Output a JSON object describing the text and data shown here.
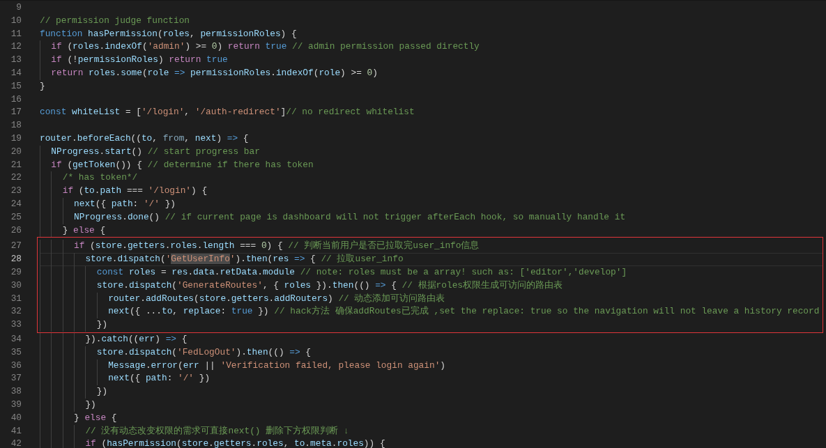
{
  "editor": {
    "blocks": [
      {
        "boxed": false,
        "lines": [
          {
            "number": "9",
            "current": false
          },
          {
            "number": "10",
            "current": false,
            "tokens": [
              {
                "kind": "comment",
                "text": "// permission judge function"
              }
            ]
          },
          {
            "number": "11",
            "current": false,
            "tokens": [
              {
                "kind": "keyword",
                "text": "function"
              },
              {
                "kind": "ident",
                "text": " hasPermission"
              },
              {
                "kind": "plain",
                "text": "("
              },
              {
                "kind": "ident",
                "text": "roles"
              },
              {
                "kind": "plain",
                "text": ", "
              },
              {
                "kind": "ident",
                "text": "permissionRoles"
              },
              {
                "kind": "plain",
                "text": ") {"
              }
            ]
          },
          {
            "number": "12",
            "current": false,
            "tokens": [
              {
                "kind": "control",
                "text": "  if"
              },
              {
                "kind": "plain",
                "text": " ("
              },
              {
                "kind": "ident",
                "text": "roles"
              },
              {
                "kind": "plain",
                "text": "."
              },
              {
                "kind": "ident",
                "text": "indexOf"
              },
              {
                "kind": "plain",
                "text": "("
              },
              {
                "kind": "string",
                "text": "'admin'"
              },
              {
                "kind": "plain",
                "text": ") >= "
              },
              {
                "kind": "number",
                "text": "0"
              },
              {
                "kind": "plain",
                "text": ") "
              },
              {
                "kind": "control",
                "text": "return"
              },
              {
                "kind": "keyword",
                "text": " true"
              },
              {
                "kind": "comment",
                "text": " // admin permission passed directly"
              }
            ]
          },
          {
            "number": "13",
            "current": false,
            "tokens": [
              {
                "kind": "control",
                "text": "  if"
              },
              {
                "kind": "plain",
                "text": " (!"
              },
              {
                "kind": "ident",
                "text": "permissionRoles"
              },
              {
                "kind": "plain",
                "text": ") "
              },
              {
                "kind": "control",
                "text": "return"
              },
              {
                "kind": "keyword",
                "text": " true"
              }
            ]
          },
          {
            "number": "14",
            "current": false,
            "tokens": [
              {
                "kind": "control",
                "text": "  return"
              },
              {
                "kind": "ident",
                "text": " roles"
              },
              {
                "kind": "plain",
                "text": "."
              },
              {
                "kind": "ident",
                "text": "some"
              },
              {
                "kind": "plain",
                "text": "("
              },
              {
                "kind": "ident",
                "text": "role"
              },
              {
                "kind": "keyword",
                "text": " =>"
              },
              {
                "kind": "ident",
                "text": " permissionRoles"
              },
              {
                "kind": "plain",
                "text": "."
              },
              {
                "kind": "ident",
                "text": "indexOf"
              },
              {
                "kind": "plain",
                "text": "("
              },
              {
                "kind": "ident",
                "text": "role"
              },
              {
                "kind": "plain",
                "text": ") >= "
              },
              {
                "kind": "number",
                "text": "0"
              },
              {
                "kind": "plain",
                "text": ")"
              }
            ]
          },
          {
            "number": "15",
            "current": false,
            "tokens": [
              {
                "kind": "plain",
                "text": "}"
              }
            ]
          },
          {
            "number": "16",
            "current": false
          },
          {
            "number": "17",
            "current": false,
            "tokens": [
              {
                "kind": "keyword",
                "text": "const"
              },
              {
                "kind": "ident",
                "text": " whiteList"
              },
              {
                "kind": "plain",
                "text": " = ["
              },
              {
                "kind": "string",
                "text": "'/login'"
              },
              {
                "kind": "plain",
                "text": ", "
              },
              {
                "kind": "string",
                "text": "'/auth-redirect'"
              },
              {
                "kind": "plain",
                "text": "]"
              },
              {
                "kind": "comment",
                "text": "// no redirect whitelist"
              }
            ]
          },
          {
            "number": "18",
            "current": false
          },
          {
            "number": "19",
            "current": false,
            "tokens": [
              {
                "kind": "ident",
                "text": "router"
              },
              {
                "kind": "plain",
                "text": "."
              },
              {
                "kind": "ident",
                "text": "beforeEach"
              },
              {
                "kind": "plain",
                "text": "(("
              },
              {
                "kind": "ident",
                "text": "to"
              },
              {
                "kind": "plain",
                "text": ", "
              },
              {
                "kind": "dim",
                "text": "from"
              },
              {
                "kind": "plain",
                "text": ", "
              },
              {
                "kind": "ident",
                "text": "next"
              },
              {
                "kind": "plain",
                "text": ") "
              },
              {
                "kind": "keyword",
                "text": "=>"
              },
              {
                "kind": "plain",
                "text": " {"
              }
            ]
          },
          {
            "number": "20",
            "current": false,
            "tokens": [
              {
                "kind": "ident",
                "text": "  NProgress"
              },
              {
                "kind": "plain",
                "text": "."
              },
              {
                "kind": "ident",
                "text": "start"
              },
              {
                "kind": "plain",
                "text": "() "
              },
              {
                "kind": "comment",
                "text": "// start progress bar"
              }
            ]
          },
          {
            "number": "21",
            "current": false,
            "tokens": [
              {
                "kind": "control",
                "text": "  if"
              },
              {
                "kind": "plain",
                "text": " ("
              },
              {
                "kind": "ident",
                "text": "getToken"
              },
              {
                "kind": "plain",
                "text": "()) { "
              },
              {
                "kind": "comment",
                "text": "// determine if there has token"
              }
            ]
          },
          {
            "number": "22",
            "current": false,
            "tokens": [
              {
                "kind": "comment",
                "text": "    /* has token*/"
              }
            ]
          },
          {
            "number": "23",
            "current": false,
            "tokens": [
              {
                "kind": "control",
                "text": "    if"
              },
              {
                "kind": "plain",
                "text": " ("
              },
              {
                "kind": "ident",
                "text": "to"
              },
              {
                "kind": "plain",
                "text": "."
              },
              {
                "kind": "ident",
                "text": "path"
              },
              {
                "kind": "plain",
                "text": " === "
              },
              {
                "kind": "string",
                "text": "'/login'"
              },
              {
                "kind": "plain",
                "text": ") {"
              }
            ]
          },
          {
            "number": "24",
            "current": false,
            "tokens": [
              {
                "kind": "ident",
                "text": "      next"
              },
              {
                "kind": "plain",
                "text": "({ "
              },
              {
                "kind": "ident",
                "text": "path"
              },
              {
                "kind": "plain",
                "text": ": "
              },
              {
                "kind": "string",
                "text": "'/'"
              },
              {
                "kind": "plain",
                "text": " })"
              }
            ]
          },
          {
            "number": "25",
            "current": false,
            "tokens": [
              {
                "kind": "ident",
                "text": "      NProgress"
              },
              {
                "kind": "plain",
                "text": "."
              },
              {
                "kind": "ident",
                "text": "done"
              },
              {
                "kind": "plain",
                "text": "() "
              },
              {
                "kind": "comment",
                "text": "// if current page is dashboard will not trigger afterEach hook, so manually handle it"
              }
            ]
          },
          {
            "number": "26",
            "current": false,
            "tokens": [
              {
                "kind": "plain",
                "text": "    } "
              },
              {
                "kind": "control",
                "text": "else"
              },
              {
                "kind": "plain",
                "text": " {"
              }
            ]
          }
        ]
      },
      {
        "boxed": true,
        "lines": [
          {
            "number": "27",
            "current": false,
            "tokens": [
              {
                "kind": "control",
                "text": "      if"
              },
              {
                "kind": "plain",
                "text": " ("
              },
              {
                "kind": "ident",
                "text": "store"
              },
              {
                "kind": "plain",
                "text": "."
              },
              {
                "kind": "ident",
                "text": "getters"
              },
              {
                "kind": "plain",
                "text": "."
              },
              {
                "kind": "ident",
                "text": "roles"
              },
              {
                "kind": "plain",
                "text": "."
              },
              {
                "kind": "ident",
                "text": "length"
              },
              {
                "kind": "plain",
                "text": " === "
              },
              {
                "kind": "number",
                "text": "0"
              },
              {
                "kind": "plain",
                "text": ") { "
              },
              {
                "kind": "comment",
                "text": "// 判断当前用户是否已拉取完user_info信息"
              }
            ]
          },
          {
            "number": "28",
            "current": true,
            "tokens": [
              {
                "kind": "ident",
                "text": "        store"
              },
              {
                "kind": "plain",
                "text": "."
              },
              {
                "kind": "ident",
                "text": "dispatch"
              },
              {
                "kind": "plain",
                "text": "("
              },
              {
                "kind": "string",
                "text": "'"
              },
              {
                "kind": "match",
                "text": "GetUserInfo"
              },
              {
                "kind": "string",
                "text": "'"
              },
              {
                "kind": "plain",
                "text": ")."
              },
              {
                "kind": "ident",
                "text": "then"
              },
              {
                "kind": "plain",
                "text": "("
              },
              {
                "kind": "ident",
                "text": "res"
              },
              {
                "kind": "keyword",
                "text": " =>"
              },
              {
                "kind": "plain",
                "text": " { "
              },
              {
                "kind": "comment",
                "text": "// 拉取user_info"
              }
            ]
          },
          {
            "number": "29",
            "current": false,
            "tokens": [
              {
                "kind": "keyword",
                "text": "          const"
              },
              {
                "kind": "ident",
                "text": " roles"
              },
              {
                "kind": "plain",
                "text": " = "
              },
              {
                "kind": "ident",
                "text": "res"
              },
              {
                "kind": "plain",
                "text": "."
              },
              {
                "kind": "ident",
                "text": "data"
              },
              {
                "kind": "plain",
                "text": "."
              },
              {
                "kind": "ident",
                "text": "retData"
              },
              {
                "kind": "plain",
                "text": "."
              },
              {
                "kind": "ident",
                "text": "module"
              },
              {
                "kind": "comment",
                "text": " // note: roles must be a array! such as: ['editor','develop']"
              }
            ]
          },
          {
            "number": "30",
            "current": false,
            "tokens": [
              {
                "kind": "ident",
                "text": "          store"
              },
              {
                "kind": "plain",
                "text": "."
              },
              {
                "kind": "ident",
                "text": "dispatch"
              },
              {
                "kind": "plain",
                "text": "("
              },
              {
                "kind": "string",
                "text": "'GenerateRoutes'"
              },
              {
                "kind": "plain",
                "text": ", { "
              },
              {
                "kind": "ident",
                "text": "roles"
              },
              {
                "kind": "plain",
                "text": " })."
              },
              {
                "kind": "ident",
                "text": "then"
              },
              {
                "kind": "plain",
                "text": "(() "
              },
              {
                "kind": "keyword",
                "text": "=>"
              },
              {
                "kind": "plain",
                "text": " { "
              },
              {
                "kind": "comment",
                "text": "// 根据roles权限生成可访问的路由表"
              }
            ]
          },
          {
            "number": "31",
            "current": false,
            "tokens": [
              {
                "kind": "ident",
                "text": "            router"
              },
              {
                "kind": "plain",
                "text": "."
              },
              {
                "kind": "ident",
                "text": "addRoutes"
              },
              {
                "kind": "plain",
                "text": "("
              },
              {
                "kind": "ident",
                "text": "store"
              },
              {
                "kind": "plain",
                "text": "."
              },
              {
                "kind": "ident",
                "text": "getters"
              },
              {
                "kind": "plain",
                "text": "."
              },
              {
                "kind": "ident",
                "text": "addRouters"
              },
              {
                "kind": "plain",
                "text": ") "
              },
              {
                "kind": "comment",
                "text": "// 动态添加可访问路由表"
              }
            ]
          },
          {
            "number": "32",
            "current": false,
            "tokens": [
              {
                "kind": "ident",
                "text": "            next"
              },
              {
                "kind": "plain",
                "text": "({ ..."
              },
              {
                "kind": "ident",
                "text": "to"
              },
              {
                "kind": "plain",
                "text": ", "
              },
              {
                "kind": "ident",
                "text": "replace"
              },
              {
                "kind": "plain",
                "text": ": "
              },
              {
                "kind": "keyword",
                "text": "true"
              },
              {
                "kind": "plain",
                "text": " }) "
              },
              {
                "kind": "comment",
                "text": "// hack方法 确保addRoutes已完成 ,set the replace: true so the navigation will not leave a history record"
              }
            ]
          },
          {
            "number": "33",
            "current": false,
            "tokens": [
              {
                "kind": "plain",
                "text": "          })"
              }
            ]
          }
        ]
      },
      {
        "boxed": false,
        "lines": [
          {
            "number": "34",
            "current": false,
            "tokens": [
              {
                "kind": "plain",
                "text": "        })."
              },
              {
                "kind": "ident",
                "text": "catch"
              },
              {
                "kind": "plain",
                "text": "(("
              },
              {
                "kind": "ident",
                "text": "err"
              },
              {
                "kind": "plain",
                "text": ") "
              },
              {
                "kind": "keyword",
                "text": "=>"
              },
              {
                "kind": "plain",
                "text": " {"
              }
            ]
          },
          {
            "number": "35",
            "current": false,
            "tokens": [
              {
                "kind": "ident",
                "text": "          store"
              },
              {
                "kind": "plain",
                "text": "."
              },
              {
                "kind": "ident",
                "text": "dispatch"
              },
              {
                "kind": "plain",
                "text": "("
              },
              {
                "kind": "string",
                "text": "'FedLogOut'"
              },
              {
                "kind": "plain",
                "text": ")."
              },
              {
                "kind": "ident",
                "text": "then"
              },
              {
                "kind": "plain",
                "text": "(() "
              },
              {
                "kind": "keyword",
                "text": "=>"
              },
              {
                "kind": "plain",
                "text": " {"
              }
            ]
          },
          {
            "number": "36",
            "current": false,
            "tokens": [
              {
                "kind": "ident",
                "text": "            Message"
              },
              {
                "kind": "plain",
                "text": "."
              },
              {
                "kind": "ident",
                "text": "error"
              },
              {
                "kind": "plain",
                "text": "("
              },
              {
                "kind": "ident",
                "text": "err"
              },
              {
                "kind": "plain",
                "text": " || "
              },
              {
                "kind": "string",
                "text": "'Verification failed, please login again'"
              },
              {
                "kind": "plain",
                "text": ")"
              }
            ]
          },
          {
            "number": "37",
            "current": false,
            "tokens": [
              {
                "kind": "ident",
                "text": "            next"
              },
              {
                "kind": "plain",
                "text": "({ "
              },
              {
                "kind": "ident",
                "text": "path"
              },
              {
                "kind": "plain",
                "text": ": "
              },
              {
                "kind": "string",
                "text": "'/'"
              },
              {
                "kind": "plain",
                "text": " })"
              }
            ]
          },
          {
            "number": "38",
            "current": false,
            "tokens": [
              {
                "kind": "plain",
                "text": "          })"
              }
            ]
          },
          {
            "number": "39",
            "current": false,
            "tokens": [
              {
                "kind": "plain",
                "text": "        })"
              }
            ]
          },
          {
            "number": "40",
            "current": false,
            "tokens": [
              {
                "kind": "plain",
                "text": "      } "
              },
              {
                "kind": "control",
                "text": "else"
              },
              {
                "kind": "plain",
                "text": " {"
              }
            ]
          },
          {
            "number": "41",
            "current": false,
            "tokens": [
              {
                "kind": "comment",
                "text": "        // 没有动态改变权限的需求可直接next() 删除下方权限判断 ↓"
              }
            ]
          },
          {
            "number": "42",
            "current": false,
            "tokens": [
              {
                "kind": "control",
                "text": "        if"
              },
              {
                "kind": "plain",
                "text": " ("
              },
              {
                "kind": "ident",
                "text": "hasPermission"
              },
              {
                "kind": "plain",
                "text": "("
              },
              {
                "kind": "ident",
                "text": "store"
              },
              {
                "kind": "plain",
                "text": "."
              },
              {
                "kind": "ident",
                "text": "getters"
              },
              {
                "kind": "plain",
                "text": "."
              },
              {
                "kind": "ident",
                "text": "roles"
              },
              {
                "kind": "plain",
                "text": ", "
              },
              {
                "kind": "ident",
                "text": "to"
              },
              {
                "kind": "plain",
                "text": "."
              },
              {
                "kind": "ident",
                "text": "meta"
              },
              {
                "kind": "plain",
                "text": "."
              },
              {
                "kind": "ident",
                "text": "roles"
              },
              {
                "kind": "plain",
                "text": ")) {"
              }
            ]
          }
        ]
      }
    ]
  }
}
